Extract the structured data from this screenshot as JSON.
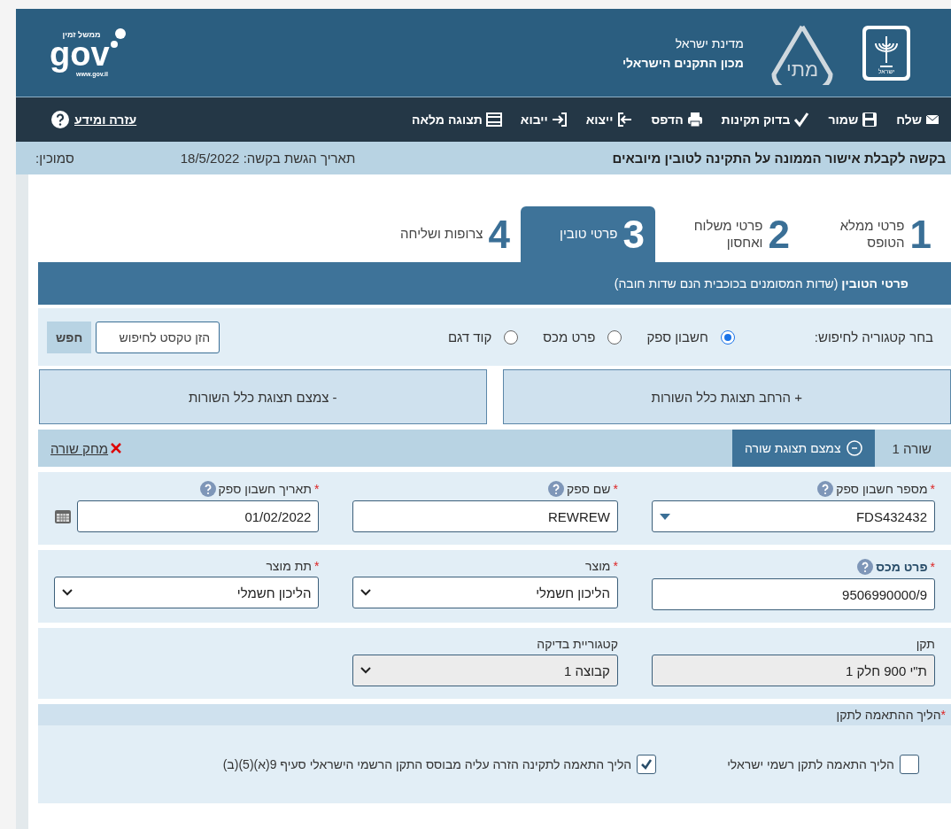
{
  "header": {
    "state_name": "מדינת ישראל",
    "institute_name": "מכון התקנים הישראלי",
    "mati_logo_text": "מתי",
    "emblem_text": "ישראל",
    "gov_logo": {
      "tagline": "ממשל זמין",
      "wordmark": "gov",
      "url": "www.gov.il"
    }
  },
  "toolbar": {
    "items": [
      {
        "kind": "send",
        "label": "שלח"
      },
      {
        "kind": "save",
        "label": "שמור"
      },
      {
        "kind": "check",
        "label": "בדוק תקינות"
      },
      {
        "kind": "print",
        "label": "הדפס"
      },
      {
        "kind": "export",
        "label": "ייצוא"
      },
      {
        "kind": "import",
        "label": "ייבוא"
      },
      {
        "kind": "fullscreen",
        "label": "תצוגה מלאה"
      }
    ],
    "help_link": "עזרה ומידע"
  },
  "title_bar": {
    "title": "בקשה לקבלת אישור הממונה על התקינה לטובין מיובאים",
    "submit_date": "תאריך הגשת בקשה: 18/5/2022",
    "reference": "סמוכין:"
  },
  "steps": [
    {
      "number": "1",
      "label": "פרטי ממלא הטופס",
      "selected": false
    },
    {
      "number": "2",
      "label": "פרטי משלוח ואחסון",
      "selected": false
    },
    {
      "number": "3",
      "label": "פרטי טובין",
      "selected": true
    },
    {
      "number": "4",
      "label": "צרופות ושליחה",
      "selected": false
    }
  ],
  "section_title": "**פרטי הטובין** (שדות המסומנים בכוכבית הנם שדות חובה)",
  "search": {
    "label": "בחר קטגוריה לחיפוש:",
    "options": [
      {
        "label": "חשבון ספק",
        "selected": true
      },
      {
        "label": "פרט מכס",
        "selected": false
      },
      {
        "label": "קוד דגם",
        "selected": false
      }
    ],
    "placeholder": "הזן טקסט לחיפוש",
    "button": "חפש"
  },
  "expand_all": "+ הרחב תצוגת כלל השורות",
  "collapse_all": "- צמצם תצוגת כלל השורות",
  "row": {
    "label": "שורה 1",
    "collapse_button": "צמצם תצוגת שורה",
    "delete_link": "מחק שורה"
  },
  "field_groups": [
    {
      "fields": [
        {
          "label": "מספר חשבון ספק",
          "required": true,
          "bold": false,
          "help": true,
          "kind": "combo",
          "value": "FDS432432",
          "disabled": false
        },
        {
          "label": "שם ספק",
          "required": true,
          "bold": false,
          "help": true,
          "kind": "text",
          "value": "REWREW",
          "disabled": false
        },
        {
          "label": "תאריך חשבון ספק",
          "required": true,
          "bold": false,
          "help": true,
          "kind": "date",
          "value": "01/02/2022",
          "disabled": false
        }
      ]
    },
    {
      "fields": [
        {
          "label": "פרט מכס",
          "required": true,
          "bold": true,
          "help": true,
          "kind": "text",
          "value": "9506990000/9",
          "disabled": false
        },
        {
          "label": "מוצר",
          "required": true,
          "bold": false,
          "help": false,
          "kind": "select",
          "value": "הליכון חשמלי",
          "disabled": false
        },
        {
          "label": "תת מוצר",
          "required": true,
          "bold": false,
          "help": false,
          "kind": "select",
          "value": "הליכון חשמלי",
          "disabled": false
        }
      ]
    },
    {
      "fields": [
        {
          "label": "תקן",
          "required": false,
          "bold": false,
          "help": false,
          "kind": "text",
          "value": "ת\"י 900 חלק 1",
          "disabled": true
        },
        {
          "label": "קטגוריית בדיקה",
          "required": false,
          "bold": false,
          "help": false,
          "kind": "select",
          "value": "קבוצה 1",
          "disabled": true
        }
      ]
    }
  ],
  "compliance": {
    "title": "הליך ההתאמה לתקן",
    "mark": "*",
    "options": [
      {
        "label": "הליך התאמה לתקן רשמי ישראלי",
        "checked": false
      },
      {
        "label": "הליך התאמה לתקינה הזרה עליה מבוסס התקן הרשמי הישראלי סעיף 9(א)(5)(ב)",
        "checked": true
      }
    ]
  }
}
